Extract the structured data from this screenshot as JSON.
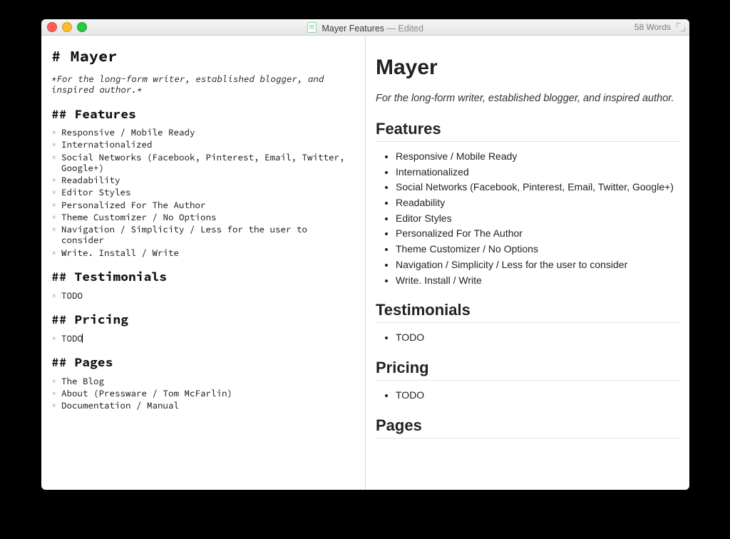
{
  "window": {
    "filename": "Mayer Features",
    "status": "— Edited",
    "wordcount": "58 Words"
  },
  "doc": {
    "title_src": "# Mayer",
    "title": "Mayer",
    "tagline_src": "*For the long-form writer, established blogger, and inspired author.*",
    "tagline": "For the long-form writer, established blogger, and inspired author.",
    "sections": {
      "features": {
        "heading_src": "## Features",
        "heading": "Features",
        "items": [
          "Responsive / Mobile Ready",
          "Internationalized",
          "Social Networks (Facebook, Pinterest, Email, Twitter, Google+)",
          "Readability",
          "Editor Styles",
          "Personalized For The Author",
          "Theme Customizer / No Options",
          "Navigation / Simplicity / Less for the user to consider",
          "Write. Install / Write"
        ]
      },
      "testimonials": {
        "heading_src": "## Testimonials",
        "heading": "Testimonials",
        "items": [
          "TODO"
        ]
      },
      "pricing": {
        "heading_src": "## Pricing",
        "heading": "Pricing",
        "items": [
          "TODO"
        ]
      },
      "pages": {
        "heading_src": "## Pages",
        "heading": "Pages",
        "items": [
          "The Blog",
          "About (Pressware / Tom McFarlin)",
          "Documentation / Manual"
        ]
      }
    }
  }
}
